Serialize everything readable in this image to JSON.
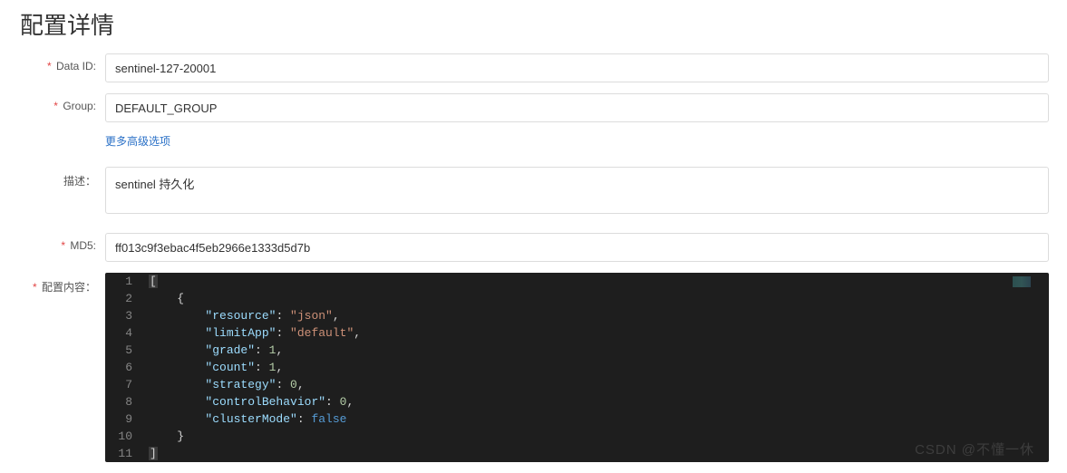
{
  "title": "配置详情",
  "labels": {
    "dataId": "Data ID:",
    "group": "Group:",
    "desc": "描述：",
    "md5": "MD5:",
    "content": "配置内容："
  },
  "fields": {
    "dataId": "sentinel-127-20001",
    "group": "DEFAULT_GROUP",
    "desc": "sentinel 持久化",
    "md5": "ff013c9f3ebac4f5eb2966e1333d5d7b"
  },
  "advancedLink": "更多高级选项",
  "editor": {
    "lines": [
      {
        "n": 1,
        "indent": "",
        "tokens": [
          {
            "t": "brk",
            "v": "["
          }
        ]
      },
      {
        "n": 2,
        "indent": "    ",
        "tokens": [
          {
            "t": "punct",
            "v": "{"
          }
        ]
      },
      {
        "n": 3,
        "indent": "        ",
        "tokens": [
          {
            "t": "key",
            "v": "\"resource\""
          },
          {
            "t": "punct",
            "v": ": "
          },
          {
            "t": "str",
            "v": "\"json\""
          },
          {
            "t": "punct",
            "v": ","
          }
        ]
      },
      {
        "n": 4,
        "indent": "        ",
        "tokens": [
          {
            "t": "key",
            "v": "\"limitApp\""
          },
          {
            "t": "punct",
            "v": ": "
          },
          {
            "t": "str",
            "v": "\"default\""
          },
          {
            "t": "punct",
            "v": ","
          }
        ]
      },
      {
        "n": 5,
        "indent": "        ",
        "tokens": [
          {
            "t": "key",
            "v": "\"grade\""
          },
          {
            "t": "punct",
            "v": ": "
          },
          {
            "t": "num",
            "v": "1"
          },
          {
            "t": "punct",
            "v": ","
          }
        ]
      },
      {
        "n": 6,
        "indent": "        ",
        "tokens": [
          {
            "t": "key",
            "v": "\"count\""
          },
          {
            "t": "punct",
            "v": ": "
          },
          {
            "t": "num",
            "v": "1"
          },
          {
            "t": "punct",
            "v": ","
          }
        ]
      },
      {
        "n": 7,
        "indent": "        ",
        "tokens": [
          {
            "t": "key",
            "v": "\"strategy\""
          },
          {
            "t": "punct",
            "v": ": "
          },
          {
            "t": "num",
            "v": "0"
          },
          {
            "t": "punct",
            "v": ","
          }
        ]
      },
      {
        "n": 8,
        "indent": "        ",
        "tokens": [
          {
            "t": "key",
            "v": "\"controlBehavior\""
          },
          {
            "t": "punct",
            "v": ": "
          },
          {
            "t": "num",
            "v": "0"
          },
          {
            "t": "punct",
            "v": ","
          }
        ]
      },
      {
        "n": 9,
        "indent": "        ",
        "tokens": [
          {
            "t": "key",
            "v": "\"clusterMode\""
          },
          {
            "t": "punct",
            "v": ": "
          },
          {
            "t": "bool",
            "v": "false"
          }
        ]
      },
      {
        "n": 10,
        "indent": "    ",
        "tokens": [
          {
            "t": "punct",
            "v": "}"
          }
        ]
      },
      {
        "n": 11,
        "indent": "",
        "tokens": [
          {
            "t": "brk",
            "v": "]"
          }
        ]
      }
    ]
  },
  "watermark": "CSDN @不懂一休"
}
